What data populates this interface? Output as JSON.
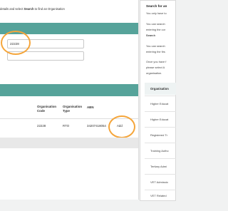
{
  "search": {
    "instruction_prefix": "details and select ",
    "instruction_bold": "Search",
    "instruction_suffix": " to find an Organisation",
    "value": "22228"
  },
  "results_table": {
    "headers": {
      "code": "Organisation Code",
      "type": "Organisation Type",
      "abn": "ABN"
    },
    "row": {
      "code": "22228",
      "type": "RTO",
      "abn": "34207418054",
      "action": "Add"
    }
  },
  "help_panel": {
    "title": "Search for an",
    "line1": "You only have to",
    "line2a": "You can search",
    "line2b": "entering the cor",
    "line2c": "Search",
    "line3a": "You can search",
    "line3b": "entering the firs",
    "line4a": "Once you have f",
    "line4b": "please select A",
    "line4c": "organisation.",
    "list_header": "Organisation",
    "items": [
      "Higher Educat",
      "Higher Educat",
      "Registered Tr",
      "Training Autho",
      "Tertiary Admi",
      "VET Admissio",
      "VET Related"
    ]
  },
  "colors": {
    "accent": "#56a39a",
    "highlight": "#f5a53a"
  }
}
